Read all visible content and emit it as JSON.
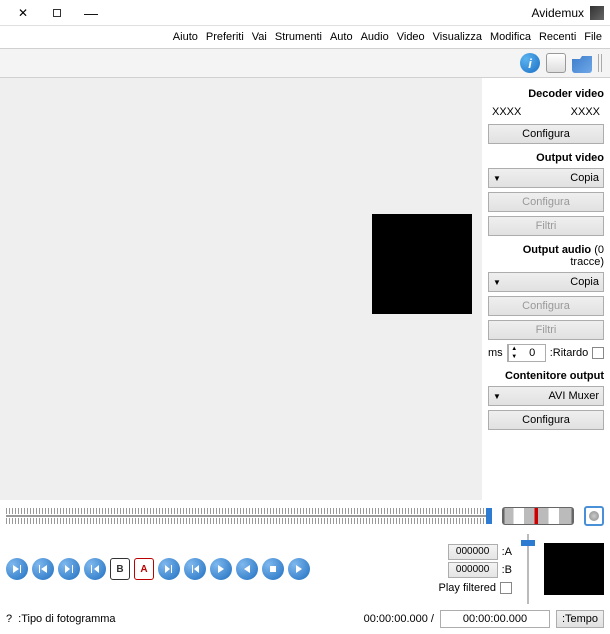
{
  "window": {
    "title": "Avidemux"
  },
  "menu": [
    "File",
    "Recenti",
    "Modifica",
    "Visualizza",
    "Video",
    "Audio",
    "Auto",
    "Strumenti",
    "Vai",
    "Preferiti",
    "Aiuto"
  ],
  "toolbar_icons": [
    "open-file-icon",
    "blank-doc-icon",
    "info-icon"
  ],
  "sidebar": {
    "decoder": {
      "label": "Decoder video",
      "left": "XXXX",
      "right": "XXXX",
      "configure": "Configura"
    },
    "video_out": {
      "label": "Output video",
      "codec": "Copia",
      "configure": "Configura",
      "filters": "Filtri"
    },
    "audio_out": {
      "label": "Output audio",
      "note": "(0 tracce)",
      "codec": "Copia",
      "configure": "Configura",
      "filters": "Filtri",
      "delay_label": "Ritardo:",
      "delay_value": "0",
      "delay_unit": "ms"
    },
    "container": {
      "label": "Contenitore output",
      "muxer": "AVI Muxer",
      "configure": "Configura"
    }
  },
  "markers": {
    "a_label": "A:",
    "a_value": "000000",
    "b_label": "B:",
    "b_value": "000000",
    "play_filtered": "Play filtered"
  },
  "status": {
    "time_label": "Tempo:",
    "time_value": "00:00:00.000",
    "total": "/ 00:00:00.000",
    "frame_type_label": "Tipo di fotogramma:",
    "frame_type_value": "?"
  },
  "info_glyph": "i"
}
